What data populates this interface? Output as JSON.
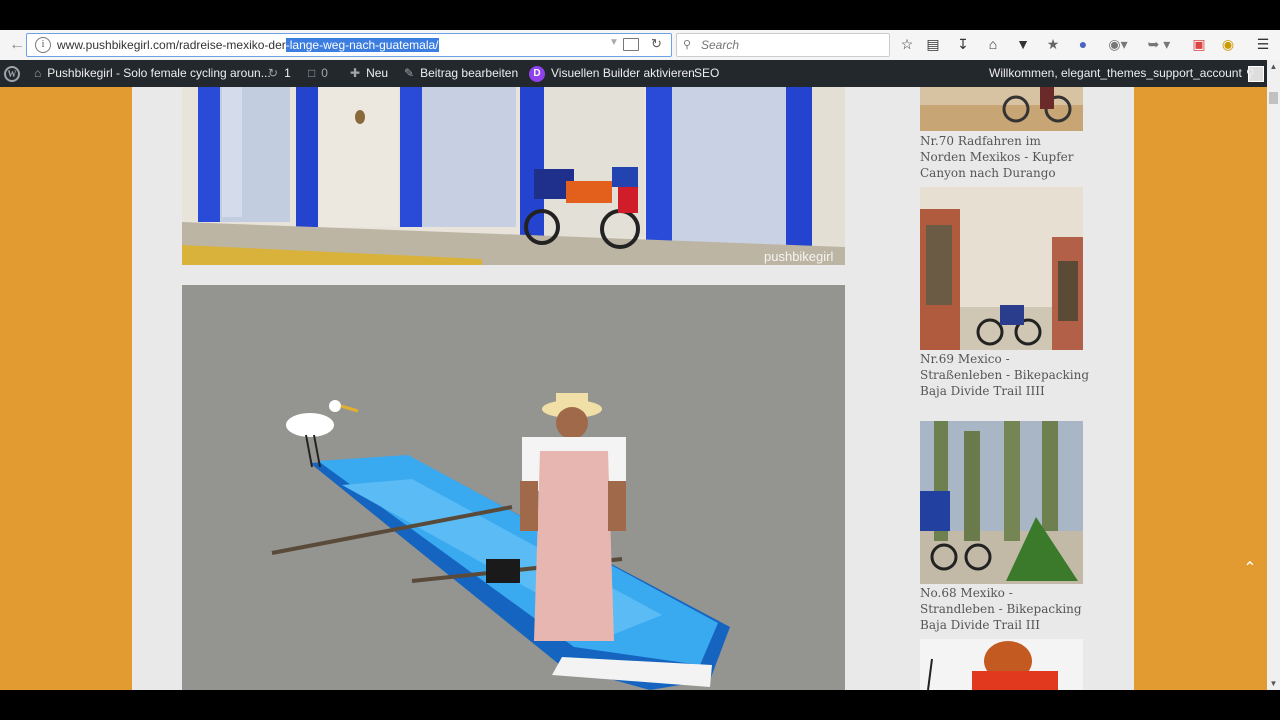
{
  "browser": {
    "url_prefix": "www.pushbikegirl.com/radreise-mexiko-der",
    "url_selected": "-lange-weg-nach-guatemala/",
    "search_placeholder": "Search",
    "back_icon": "back-arrow-icon",
    "info_icon": "info-icon",
    "reload_icon": "reload-icon",
    "toolbar_icons": [
      "bookmark-star-icon",
      "reading-list-icon",
      "download-icon",
      "home-icon",
      "pocket-icon",
      "extension-icon",
      "extension-icon",
      "extension-icon",
      "extension-icon",
      "extension-icon",
      "extension-icon",
      "menu-icon"
    ]
  },
  "admin_bar": {
    "site_name": "Pushbikegirl - Solo female cycling aroun...",
    "updates_count": "1",
    "comments_count": "0",
    "new_label": "Neu",
    "edit_post_label": "Beitrag bearbeiten",
    "divi_letter": "D",
    "visual_builder_label": "Visuellen Builder aktivieren",
    "seo_label": "SEO",
    "greeting": "Willkommen, elegant_themes_support_account"
  },
  "article": {
    "image1_watermark": "pushbikegirl"
  },
  "sidebar": {
    "posts": [
      {
        "title": "Nr.70 Radfahren im Norden Mexikos - Kupfer Canyon nach Durango"
      },
      {
        "title": "Nr.69 Mexico - Straßenleben - Bikepacking Baja Divide Trail IIII"
      },
      {
        "title": "No.68 Mexiko - Strandleben - Bikepacking Baja Divide Trail III"
      }
    ]
  },
  "colors": {
    "page_bg": "#e19b31",
    "content_bg": "#e9e9e9",
    "admin_bar": "#23282d",
    "selection": "#3b7de0"
  }
}
